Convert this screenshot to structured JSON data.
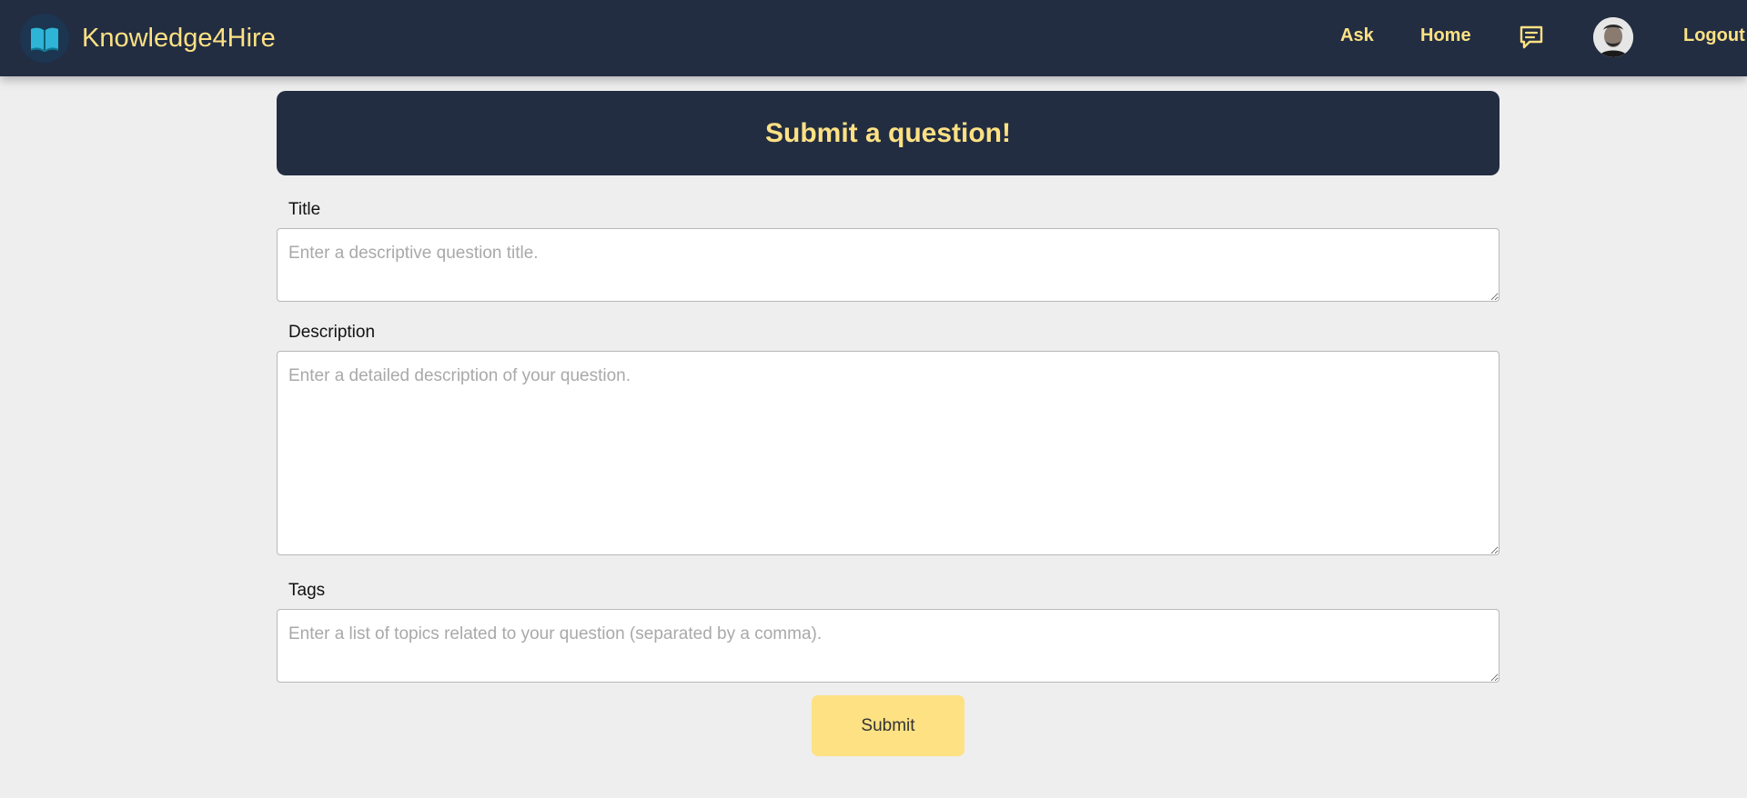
{
  "navbar": {
    "brand": "Knowledge4Hire",
    "links": {
      "ask": "Ask",
      "home": "Home",
      "logout": "Logout"
    }
  },
  "form": {
    "heading": "Submit a question!",
    "title": {
      "label": "Title",
      "value": "",
      "placeholder": "Enter a descriptive question title."
    },
    "description": {
      "label": "Description",
      "value": "",
      "placeholder": "Enter a detailed description of your question."
    },
    "tags": {
      "label": "Tags",
      "value": "",
      "placeholder": "Enter a list of topics related to your question (separated by a comma)."
    },
    "submit_label": "Submit"
  },
  "colors": {
    "navbar_bg": "#222d42",
    "accent": "#fde183",
    "page_bg": "#eeeeee",
    "logo_book": "#2eb4d6"
  },
  "icons": [
    "book-logo-icon",
    "chat-icon",
    "user-avatar"
  ]
}
